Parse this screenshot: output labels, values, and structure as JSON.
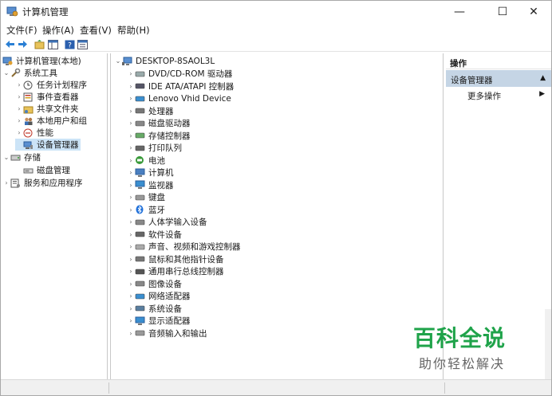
{
  "window": {
    "title": "计算机管理",
    "controls": {
      "minimize": "—",
      "maximize": "☐",
      "close": "✕"
    }
  },
  "menu": [
    "文件(F)",
    "操作(A)",
    "查看(V)",
    "帮助(H)"
  ],
  "toolbar": [
    "back-arrow-icon",
    "forward-arrow-icon",
    "up-folder-icon",
    "show-hide-tree-icon",
    "help-icon",
    "properties-icon"
  ],
  "left_tree": {
    "root": "计算机管理(本地)",
    "system_tools": "系统工具",
    "task_scheduler": "任务计划程序",
    "event_viewer": "事件查看器",
    "shared_folders": "共享文件夹",
    "local_users": "本地用户和组",
    "performance": "性能",
    "device_manager": "设备管理器",
    "storage": "存储",
    "disk_management": "磁盘管理",
    "services": "服务和应用程序"
  },
  "devices": {
    "computer_name": "DESKTOP-8SAOL3L",
    "items": [
      "DVD/CD-ROM 驱动器",
      "IDE ATA/ATAPI 控制器",
      "Lenovo Vhid Device",
      "处理器",
      "磁盘驱动器",
      "存储控制器",
      "打印队列",
      "电池",
      "计算机",
      "监视器",
      "键盘",
      "蓝牙",
      "人体学输入设备",
      "软件设备",
      "声音、视频和游戏控制器",
      "鼠标和其他指针设备",
      "通用串行总线控制器",
      "图像设备",
      "网络适配器",
      "系统设备",
      "显示适配器",
      "音频输入和输出"
    ]
  },
  "actions": {
    "title": "操作",
    "group": "设备管理器",
    "more": "更多操作"
  },
  "watermark": {
    "big": "百科全说",
    "small": "助你轻松解决"
  },
  "colors": {
    "selection": "#cce4f7",
    "actions_header": "#c5d5e5",
    "watermark_green": "#1fa34a"
  }
}
